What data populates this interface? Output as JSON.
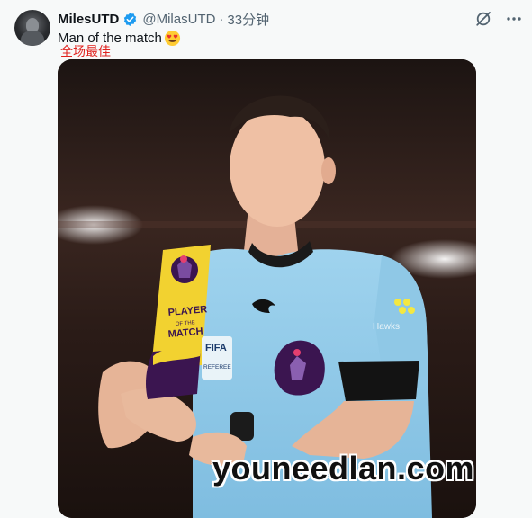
{
  "tweet": {
    "display_name": "MilesUTD",
    "handle": "@MilasUTD",
    "separator": "·",
    "time": "33分钟",
    "text": "Man of the match",
    "emoji": "heart-eyes-emoji",
    "translation": "全场最佳"
  },
  "media": {
    "trophy_line1": "PLAYER",
    "trophy_line2": "OF THE",
    "trophy_line3": "MATCH",
    "patch_text_1": "FIFA",
    "patch_text_2": "REFEREE",
    "sponsor_text": "Hawks"
  },
  "watermark": "youneedlan.com",
  "colors": {
    "verified": "#1d9bf0",
    "jersey": "#8fc8e6",
    "trophy_yellow": "#f2d230",
    "trophy_purple": "#3b1550",
    "translation": "#e0221e"
  }
}
